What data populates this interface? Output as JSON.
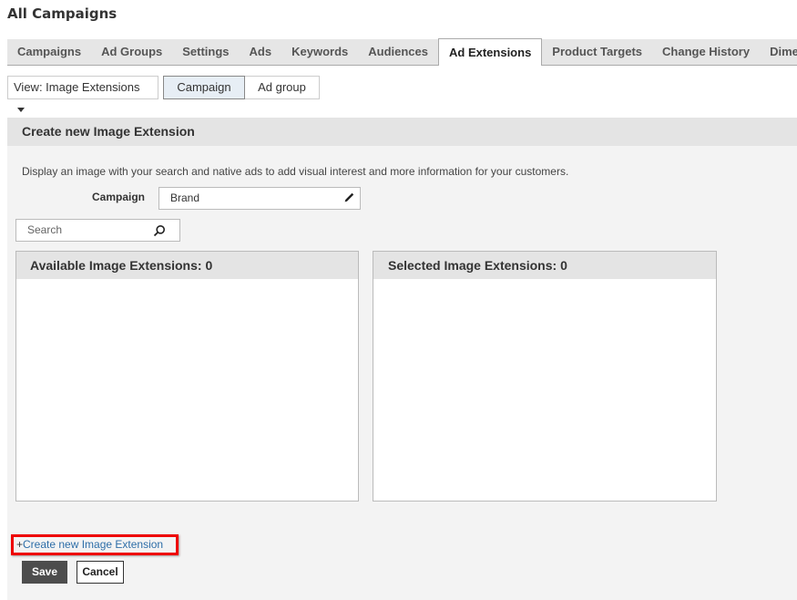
{
  "page": {
    "title": "All Campaigns"
  },
  "tabs": [
    {
      "label": "Campaigns",
      "active": false
    },
    {
      "label": "Ad Groups",
      "active": false
    },
    {
      "label": "Settings",
      "active": false
    },
    {
      "label": "Ads",
      "active": false
    },
    {
      "label": "Keywords",
      "active": false
    },
    {
      "label": "Audiences",
      "active": false
    },
    {
      "label": "Ad Extensions",
      "active": true
    },
    {
      "label": "Product Targets",
      "active": false
    },
    {
      "label": "Change History",
      "active": false
    },
    {
      "label": "Dimensions",
      "active": false
    }
  ],
  "view": {
    "prefix": "View: ",
    "selected": "Image Extensions",
    "level_options": [
      "Campaign",
      "Ad group"
    ],
    "level_selected": "Campaign"
  },
  "form": {
    "header": "Create new Image Extension",
    "description": "Display an image with your search and native ads to add visual interest and more information for your customers.",
    "campaign_label": "Campaign",
    "campaign_value": "Brand",
    "search_placeholder": "Search",
    "search_value": "",
    "available_header": "Available Image Extensions: 0",
    "selected_header": "Selected Image Extensions:  0",
    "create_prefix": "+",
    "create_link": "Create new Image Extension",
    "save_label": "Save",
    "cancel_label": "Cancel"
  },
  "icons": {
    "view_caret": "caret-down-icon",
    "campaign_edit": "pencil-icon",
    "search": "search-icon"
  },
  "colors": {
    "link": "#2e6ea8",
    "highlight_box": "#ee0000",
    "save_bg": "#4d4d4d",
    "active_segment_bg": "#e7eef5"
  }
}
